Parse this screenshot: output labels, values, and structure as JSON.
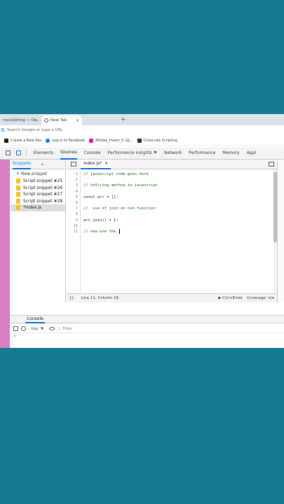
{
  "browser": {
    "tabs": [
      {
        "title": "ray.toString — Dr...",
        "active": false
      },
      {
        "title": "New Tab",
        "active": true
      }
    ],
    "new_tab_symbol": "+",
    "omnibox_placeholder": "Search Google or type a URL",
    "bookmarks": [
      {
        "label": "Create a New Pen",
        "icon": "codepen-icon"
      },
      {
        "label": "Log in to Facebook",
        "icon": "facebook-icon"
      },
      {
        "label": "Mickey_fraser_5 (@...",
        "icon": "instagram-icon"
      },
      {
        "label": "Cross-site Scripting",
        "icon": "bookmark-icon"
      }
    ]
  },
  "devtools": {
    "tabs": [
      "Elements",
      "Sources",
      "Console",
      "Performance insights ⚑",
      "Network",
      "Performance",
      "Memory",
      "Appl"
    ],
    "active_tab": "Sources",
    "navigator": {
      "tab_label": "Snippets",
      "more_symbol": "»",
      "new_snippet_label": "+ New snippet",
      "snippets": [
        "Script snippet #25",
        "Script snippet #26",
        "Script snippet #27",
        "Script snippet #28",
        "*index.js"
      ],
      "selected": "*index.js"
    },
    "editor": {
      "file_tab": "index.js*",
      "close_symbol": "×",
      "line_numbers": [
        "1",
        "2",
        "3",
        "4",
        "5",
        "6",
        "7",
        "8",
        "9",
        "10",
        "11"
      ],
      "lines": [
        "// javascript code goes here",
        "",
        "// toString method in javascript",
        "",
        "const arr = [];",
        "",
        "//  use of join on non function",
        "",
        "arr.join() = 1;",
        "",
        "// now use the "
      ],
      "status": {
        "braces": "{}",
        "position": "Line 11, Column 16",
        "run": "▶ Ctrl+Enter",
        "coverage": "Coverage: n/a"
      }
    },
    "drawer": {
      "tab": "Console",
      "context": "top",
      "context_arrow": "▼",
      "filter_placeholder": "Filter",
      "prompt": "›"
    }
  }
}
